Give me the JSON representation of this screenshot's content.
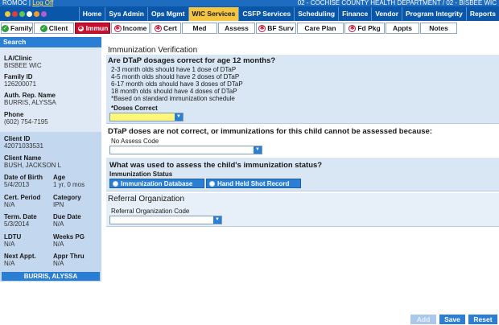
{
  "topbar": {
    "app_code": "ROMOC",
    "logout_label": "Log Off",
    "department": "02 - COCHISE COUNTY HEALTH DEPARTMENT / 02 - BISBEE WIC"
  },
  "menu": {
    "items": [
      "Home",
      "Sys Admin",
      "Ops Mgmt",
      "WIC Services",
      "CSFP Services",
      "Scheduling",
      "Finance",
      "Vendor",
      "Program Integrity",
      "Reports"
    ],
    "active": "WIC Services"
  },
  "tabs": [
    {
      "label": "Family",
      "status": "ok"
    },
    {
      "label": "Client",
      "status": "ok"
    },
    {
      "label": "Immun",
      "status": "error"
    },
    {
      "label": "Income",
      "status": "error"
    },
    {
      "label": "Cert",
      "status": "error"
    },
    {
      "label": "Med",
      "status": "none"
    },
    {
      "label": "Assess",
      "status": "none"
    },
    {
      "label": "BF Surv",
      "status": "error"
    },
    {
      "label": "Care Plan",
      "status": "none"
    },
    {
      "label": "Fd Pkg",
      "status": "error"
    },
    {
      "label": "Appts",
      "status": "none"
    },
    {
      "label": "Notes",
      "status": "none"
    }
  ],
  "sidebar": {
    "search_label": "Search",
    "la_clinic_label": "LA/Clinic",
    "la_clinic_value": "BISBEE WIC",
    "family_id_label": "Family ID",
    "family_id_value": "126200071",
    "auth_rep_label": "Auth. Rep. Name",
    "auth_rep_value": "BURRIS, ALYSSA",
    "phone_label": "Phone",
    "phone_value": "(602) 754-7195",
    "client_id_label": "Client ID",
    "client_id_value": "42071033531",
    "client_name_label": "Client Name",
    "client_name_value": "BUSH, JACKSON L",
    "dob_label": "Date of Birth",
    "dob_value": "5/4/2013",
    "age_label": "Age",
    "age_value": "1 yr, 0 mos",
    "cert_period_label": "Cert. Period",
    "cert_period_value": "N/A",
    "category_label": "Category",
    "category_value": "IPN",
    "term_date_label": "Term. Date",
    "term_date_value": "5/3/2014",
    "due_date_label": "Due Date",
    "due_date_value": "N/A",
    "ldtu_label": "LDTU",
    "ldtu_value": "N/A",
    "weeks_pg_label": "Weeks PG",
    "weeks_pg_value": "N/A",
    "next_appt_label": "Next Appt.",
    "next_appt_value": "N/A",
    "appr_thru_label": "Appr Thru",
    "appr_thru_value": "N/A",
    "name_bar": "BURRIS, ALYSSA"
  },
  "main": {
    "section_title": "Immunization Verification",
    "q1": "Are DTaP dosages correct for age 12 months?",
    "q1_lines": [
      "2-3 month olds should have 1 dose of DTaP",
      "4-5 month olds should have 2 doses of DTaP",
      "6-17 month olds should have 3 doses of DTaP",
      "18 month olds should have 4 doses of DTaP",
      "*Based on standard immunization schedule"
    ],
    "doses_correct_label": "*Doses Correct",
    "doses_correct_value": "",
    "q2": "DTaP doses are not correct, or immunizations for this child cannot be assessed because:",
    "no_assess_label": "No Assess Code",
    "no_assess_value": "",
    "q3": "What was used to assess the child's immunization status?",
    "imm_status_label": "Immunization Status",
    "radio_options": [
      "Immunization Database",
      "Hand Held Shot Record"
    ],
    "referral_title": "Referral Organization",
    "referral_code_label": "Referral Organization Code",
    "referral_code_value": ""
  },
  "buttons": {
    "add": "Add",
    "save": "Save",
    "reset": "Reset"
  },
  "colors": {
    "brand_blue": "#0a56a8",
    "accent_blue": "#2a7fd4",
    "active_menu": "#f4c542",
    "active_tab": "#c8102e",
    "ok_green": "#2e9e3a",
    "required_yellow": "#fff77a"
  }
}
